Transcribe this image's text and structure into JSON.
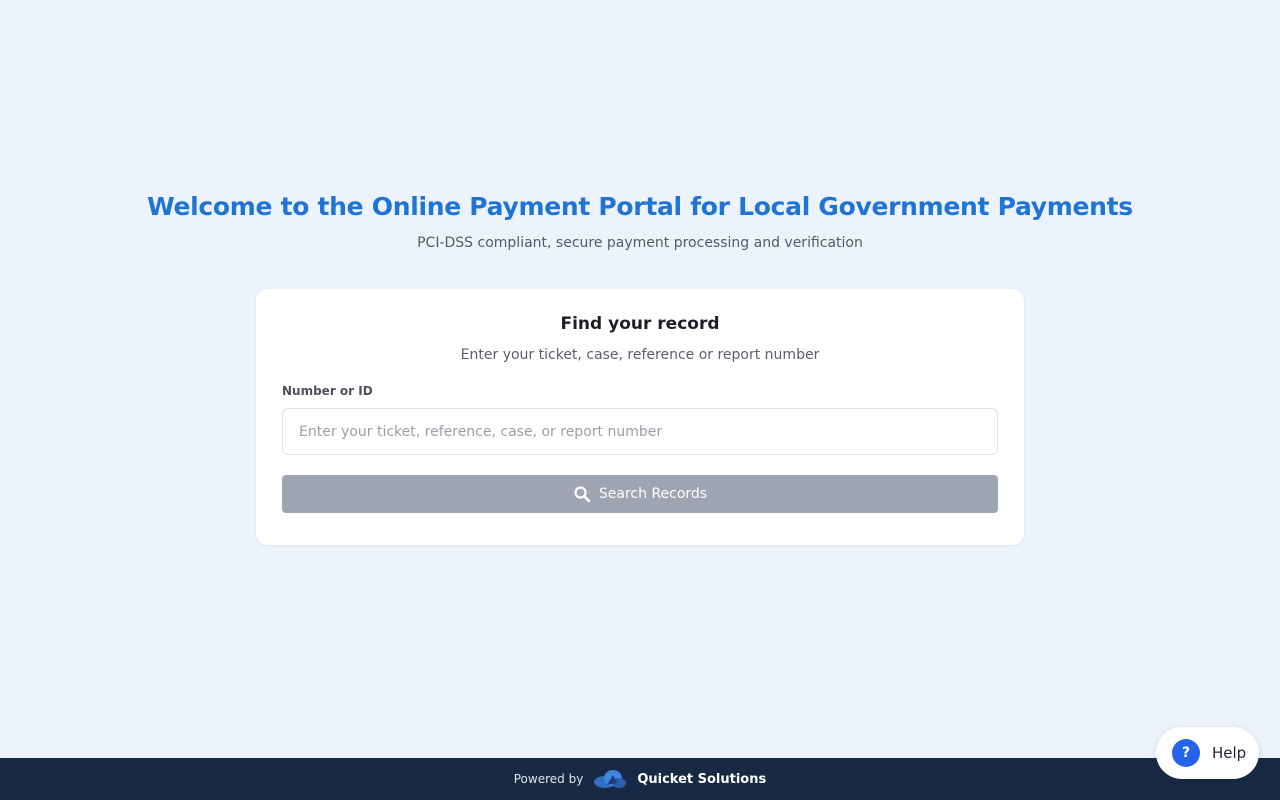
{
  "hero": {
    "title": "Welcome to the Online Payment Portal for Local Government Payments",
    "subtitle": "PCI-DSS compliant, secure payment processing and verification"
  },
  "search_card": {
    "title": "Find your record",
    "subtitle": "Enter your ticket, case, reference or report number",
    "field_label": "Number or ID",
    "input_value": "",
    "input_placeholder": "Enter your ticket, reference, case, or report number",
    "button_label": "Search Records",
    "button_icon": "search-icon",
    "button_color": "#9ea5b0"
  },
  "footer": {
    "powered_by": "Powered by",
    "company_name": "Quicket Solutions",
    "logo_icon": "cloud-logo-icon",
    "background_color": "#182a43"
  },
  "help": {
    "icon_glyph": "?",
    "label": "Help",
    "accent_color": "#2563eb"
  },
  "theme": {
    "page_background": "#edf3fd",
    "title_color": "#1f74d6"
  }
}
